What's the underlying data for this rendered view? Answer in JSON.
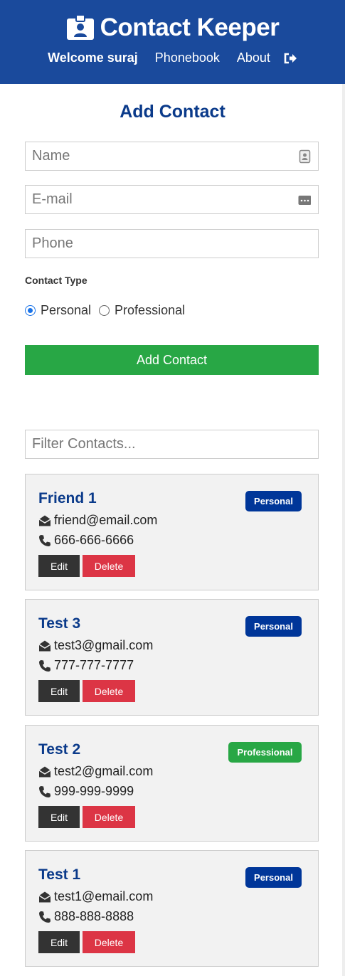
{
  "navbar": {
    "title": "Contact Keeper",
    "welcome": "Welcome suraj",
    "links": [
      "Phonebook",
      "About"
    ],
    "brand_icon": "id-badge-icon",
    "logout_icon": "sign-out-icon",
    "color": "#1a4a9c"
  },
  "form": {
    "title": "Add Contact",
    "name_placeholder": "Name",
    "email_placeholder": "E-mail",
    "phone_placeholder": "Phone",
    "type_label": "Contact Type",
    "options": [
      "Personal",
      "Professional"
    ],
    "selected": "Personal",
    "submit_label": "Add Contact",
    "submit_color": "#28a745"
  },
  "filter": {
    "placeholder": "Filter Contacts..."
  },
  "contacts": [
    {
      "name": "Friend 1",
      "email": "friend@email.com",
      "phone": "666-666-6666",
      "type": "Personal"
    },
    {
      "name": "Test 3",
      "email": "test3@gmail.com",
      "phone": "777-777-7777",
      "type": "Personal"
    },
    {
      "name": "Test 2",
      "email": "test2@gmail.com",
      "phone": "999-999-9999",
      "type": "Professional"
    },
    {
      "name": "Test 1",
      "email": "test1@email.com",
      "phone": "888-888-8888",
      "type": "Personal"
    }
  ],
  "card_actions": {
    "edit": "Edit",
    "delete": "Delete"
  },
  "colors": {
    "personal_badge": "#003699",
    "professional_badge": "#28a745",
    "delete": "#dc3545",
    "edit": "#333333"
  }
}
